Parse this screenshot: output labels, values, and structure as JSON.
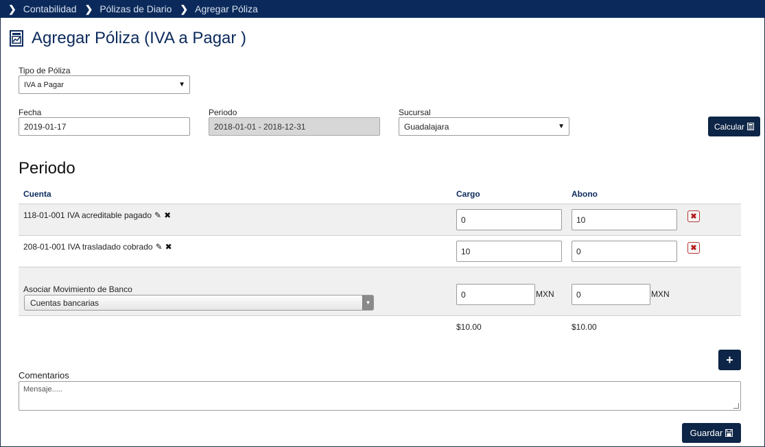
{
  "breadcrumb": {
    "items": [
      "Contabilidad",
      "Pólizas de Diario",
      "Agregar Póliza"
    ]
  },
  "page": {
    "title": "Agregar Póliza (IVA a Pagar )"
  },
  "form": {
    "tipo_label": "Tipo de Póliza",
    "tipo_value": "IVA a Pagar",
    "fecha_label": "Fecha",
    "fecha_value": "2019-01-17",
    "periodo_label": "Periodo",
    "periodo_value": "2018-01-01 - 2018-12-31",
    "sucursal_label": "Sucursal",
    "sucursal_value": "Guadalajara",
    "calcular_label": "Calcular"
  },
  "periodo": {
    "title": "Periodo",
    "headers": {
      "cuenta": "Cuenta",
      "cargo": "Cargo",
      "abono": "Abono"
    },
    "rows": [
      {
        "cuenta": "118-01-001 IVA acreditable pagado",
        "cargo": "0",
        "abono": "10"
      },
      {
        "cuenta": "208-01-001 IVA trasladado cobrado",
        "cargo": "10",
        "abono": "0"
      }
    ],
    "bank": {
      "label": "Asociar Movimiento de Banco",
      "select_value": "Cuentas bancarias",
      "cargo": "0",
      "abono": "0",
      "currency": "MXN"
    },
    "totals": {
      "cargo": "$10.00",
      "abono": "$10.00"
    }
  },
  "comentarios": {
    "label": "Comentarios",
    "placeholder": "Mensaje....."
  },
  "actions": {
    "guardar_label": "Guardar"
  },
  "colors": {
    "navy": "#0b2a5b",
    "button": "#0d2546",
    "delete": "#b31b1b"
  }
}
